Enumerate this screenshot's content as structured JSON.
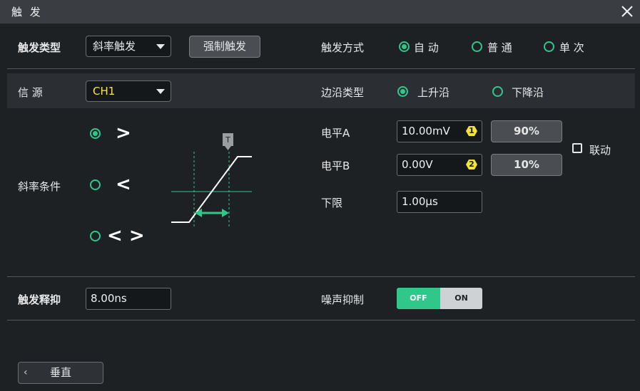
{
  "window": {
    "title": "触 发"
  },
  "trigger_type": {
    "label": "触发类型",
    "value": "斜率触发",
    "force_button": "强制触发"
  },
  "trigger_mode": {
    "label": "触发方式",
    "options": [
      {
        "label": "自 动",
        "checked": true
      },
      {
        "label": "普 通",
        "checked": false
      },
      {
        "label": "单 次",
        "checked": false
      }
    ]
  },
  "source": {
    "label": "信 源",
    "value": "CH1",
    "value_color": "#ffe23a"
  },
  "edge_type": {
    "label": "边沿类型",
    "options": [
      {
        "label": "上升沿",
        "checked": true
      },
      {
        "label": "下降沿",
        "checked": false
      }
    ]
  },
  "slope_condition": {
    "label": "斜率条件",
    "options": [
      {
        "symbol": ">",
        "checked": true
      },
      {
        "symbol": "<",
        "checked": false
      },
      {
        "symbol": "< >",
        "checked": false
      }
    ],
    "diagram_marker": "T"
  },
  "level_a": {
    "label": "电平A",
    "value": "10.00mV",
    "badge": "1",
    "percent": "90%"
  },
  "level_b": {
    "label": "电平B",
    "value": "0.00V",
    "badge": "2",
    "percent": "10%"
  },
  "link": {
    "label": "联动",
    "checked": false
  },
  "lower_limit": {
    "label": "下限",
    "value": "1.00µs"
  },
  "holdoff": {
    "label": "触发释抑",
    "value": "8.00ns"
  },
  "noise_reject": {
    "label": "噪声抑制",
    "off_label": "OFF",
    "on_label": "ON",
    "state": "OFF"
  },
  "footer": {
    "vertical_button": "垂直"
  },
  "colors": {
    "accent": "#2fc78a",
    "badge": "#f2e23a",
    "background": "#1e2124",
    "titlebar": "#3a3e43"
  }
}
